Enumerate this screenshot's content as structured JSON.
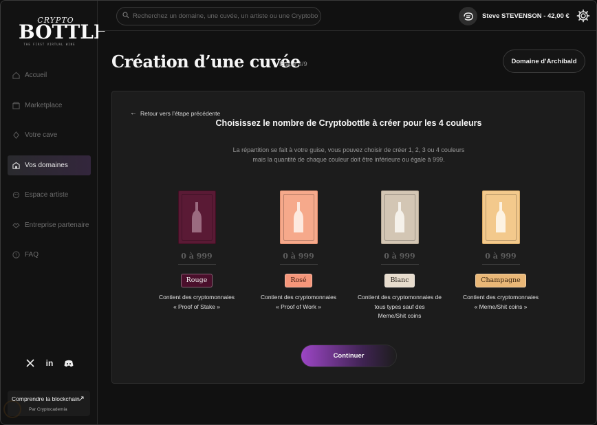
{
  "logo": {
    "top": "CRYPTO",
    "main": "BOTTLE",
    "tagline": "THE FIRST VIRTUAL WINE"
  },
  "sidebar": {
    "items": [
      {
        "label": "Accueil",
        "icon": "home-icon"
      },
      {
        "label": "Marketplace",
        "icon": "marketplace-icon"
      },
      {
        "label": "Votre cave",
        "icon": "cellar-icon"
      },
      {
        "label": "Vos domaines",
        "icon": "domain-icon"
      },
      {
        "label": "Espace artiste",
        "icon": "artist-icon"
      },
      {
        "label": "Entreprise partenaire",
        "icon": "partner-icon"
      },
      {
        "label": "FAQ",
        "icon": "faq-icon"
      }
    ],
    "active": "Vos domaines",
    "socials": [
      "x-icon",
      "linkedin-icon",
      "discord-icon"
    ],
    "learn": {
      "title": "Comprendre la blockchain",
      "subtitle": "Par Cryptocademia"
    }
  },
  "header": {
    "search_placeholder": "Recherchez un domaine, une cuvée, un artiste ou une Cryptobottle",
    "user": "Steve STEVENSON - 42,00 €"
  },
  "page": {
    "title": "Création d’une cuvée",
    "step": "Étape 4/9",
    "domain_button": "Domaine d’Archibald",
    "back": "Retour vers l’étape précédente",
    "headline": "Choisissez le nombre de Cryptobottle à créer pour les 4 couleurs",
    "desc_line1": "La répartition se fait à votre guise, vous pouvez choisir de créer 1, 2, 3 ou 4 couleurs",
    "desc_line2": "mais la quantité de chaque couleur doit être inférieure ou égale à 999.",
    "continue": "Continuer"
  },
  "colors": [
    {
      "name": "Rouge",
      "range": "0 à 999",
      "caption1": "Contient des cryptomonnaies",
      "caption2": "« Proof of Stake »",
      "caption3": "",
      "card_bg": "#5a1a35",
      "card_border": "#3e0f22",
      "bottle": "#9b6b80",
      "pill_bg": "#4a0f2b",
      "pill_text": "#f2f2f2"
    },
    {
      "name": "Rosé",
      "range": "0 à 999",
      "caption1": "Contient des cryptomonnaies",
      "caption2": "« Proof of Work »",
      "caption3": "",
      "card_bg": "#f6a98b",
      "card_border": "#e08f70",
      "bottle": "#fde9df",
      "pill_bg": "#f5967a",
      "pill_text": "#3b1a10"
    },
    {
      "name": "Blanc",
      "range": "0 à 999",
      "caption1": "Contient des cryptomonnaies de",
      "caption2": "tous types sauf des",
      "caption3": "Meme/Shit coins",
      "card_bg": "#d3c6b4",
      "card_border": "#b3a693",
      "bottle": "#f5f1ea",
      "pill_bg": "#e7dccd",
      "pill_text": "#2b2620"
    },
    {
      "name": "Champagne",
      "range": "0 à 999",
      "caption1": "Contient des cryptomonnaies",
      "caption2": "« Meme/Shit coins »",
      "caption3": "",
      "card_bg": "#f3c98c",
      "card_border": "#d8a966",
      "bottle": "#fdf3e3",
      "pill_bg": "#e9b777",
      "pill_text": "#3a2510"
    }
  ]
}
